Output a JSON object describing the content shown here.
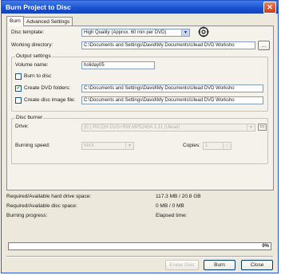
{
  "window": {
    "title": "Burn Project to Disc",
    "close_glyph": "✕"
  },
  "tabs": [
    {
      "label": "Burn"
    },
    {
      "label": "Advanced Settings"
    }
  ],
  "disc_template": {
    "label": "Disc template:",
    "value": "High Quality (Approx. 60 min per DVD)"
  },
  "working_directory": {
    "label": "Working directory:",
    "value": "C:\\Documents and Settings\\David\\My Documents\\Ulead DVD Worksho",
    "browse_label": "..."
  },
  "output_settings": {
    "group_label": "Output settings",
    "volume_name_label": "Volume name:",
    "volume_name_value": "holiday05",
    "burn_to_disc_label": "Burn to disc",
    "burn_to_disc_checked": false,
    "create_dvd_folders_label": "Create DVD folders:",
    "create_dvd_folders_checked": true,
    "create_dvd_folders_path": "C:\\Documents and Settings\\David\\My Documents\\Ulead DVD Worksho",
    "create_disc_image_label": "Create disc image file:",
    "create_disc_image_checked": false,
    "create_disc_image_path": "C:\\Documents and Settings\\David\\My Documents\\Ulead DVD Worksho"
  },
  "disc_burner": {
    "group_label": "Disc burner",
    "drive_label": "Drive:",
    "drive_value": "(E:) RICOH DVD+RW MP5240A 1.11 (Ulead)",
    "burning_speed_label": "Burning speed:",
    "burning_speed_value": "MAX",
    "copies_label": "Copies:",
    "copies_value": "1"
  },
  "status": {
    "hdd_label": "Required/Available hard drive space:",
    "hdd_value": "117.3 MB / 20.8 GB",
    "disc_label": "Required/Available disc space:",
    "disc_value": "0 MB / 0 MB",
    "progress_label": "Burning progress:",
    "elapsed_label": "Elapsed time:",
    "progress_percent": 0,
    "progress_text": "0%"
  },
  "buttons": {
    "erase_disc": "Erase Disc",
    "burn": "Burn",
    "close": "Close"
  },
  "icons": {
    "settings": "disc-settings-icon"
  }
}
